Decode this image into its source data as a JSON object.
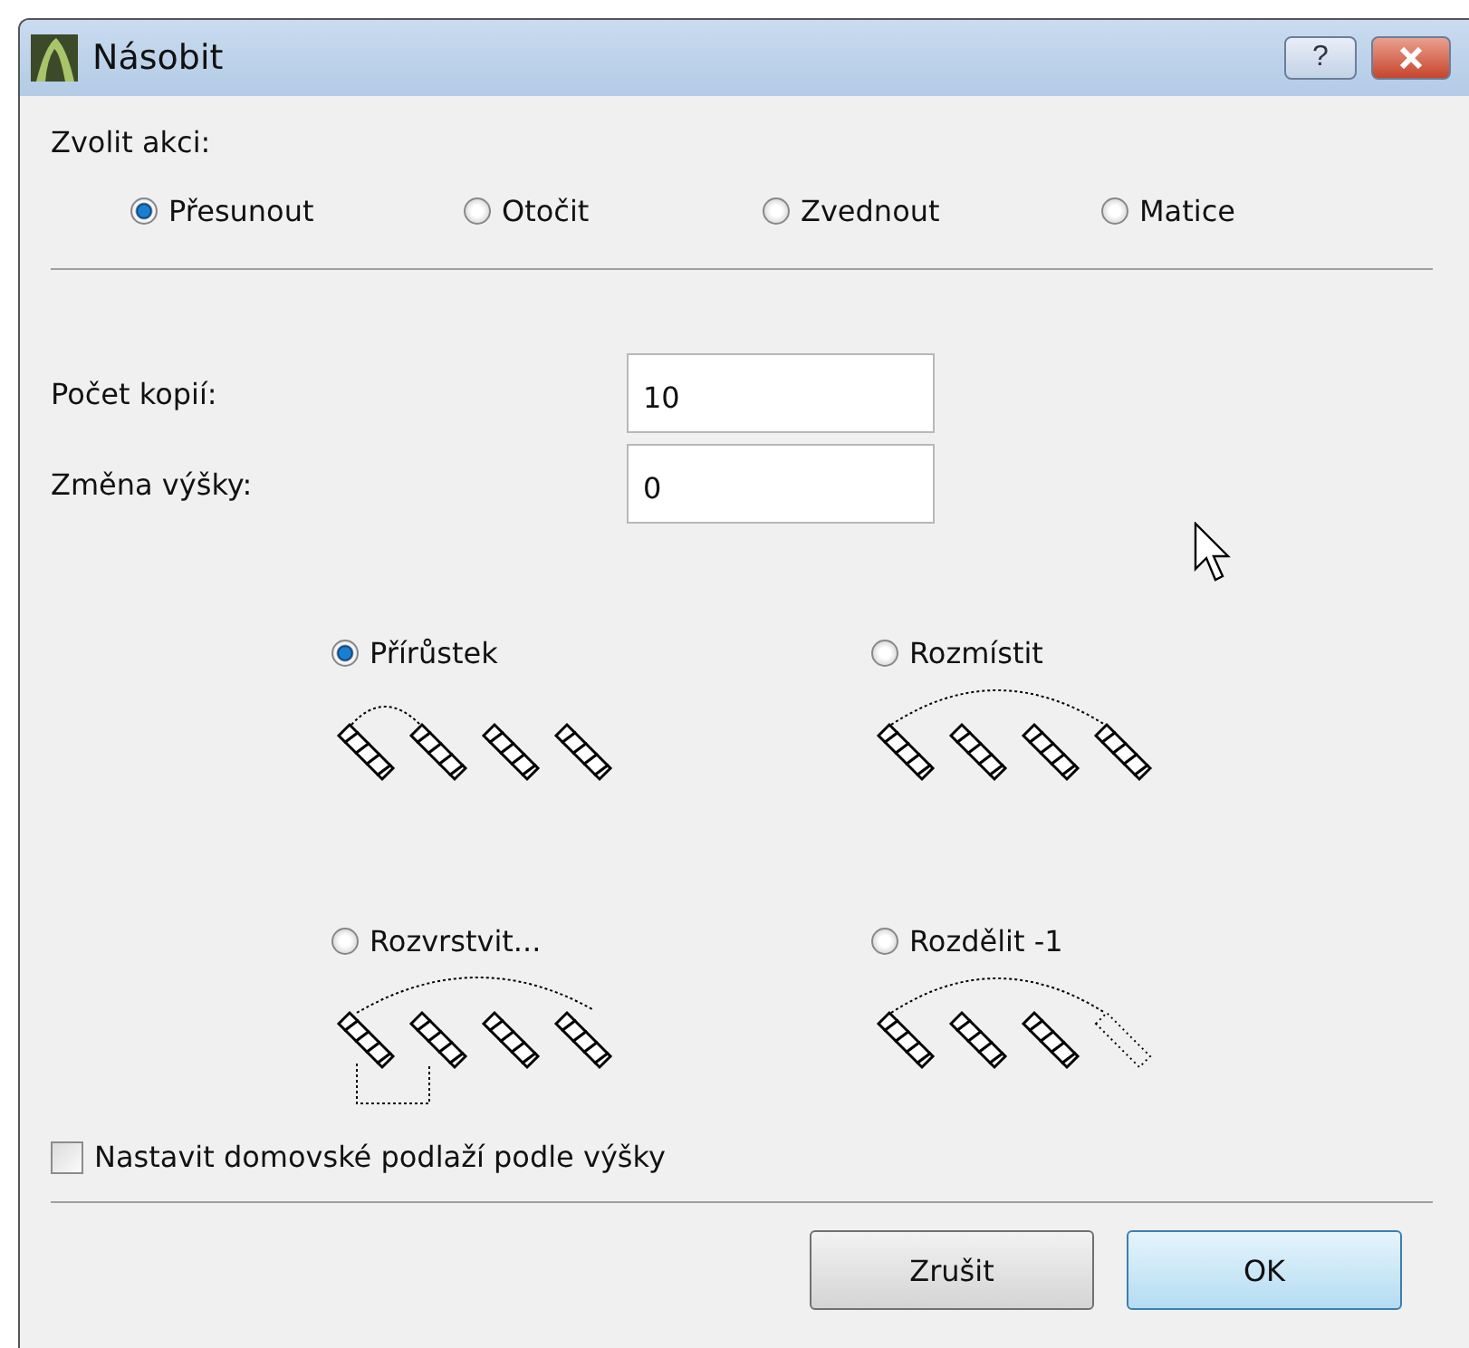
{
  "window": {
    "title": "Násobit",
    "help_button": "?"
  },
  "action": {
    "label": "Zvolit akci:",
    "options": [
      {
        "label": "Přesunout",
        "selected": true
      },
      {
        "label": "Otočit",
        "selected": false
      },
      {
        "label": "Zvednout",
        "selected": false
      },
      {
        "label": "Matice",
        "selected": false
      }
    ]
  },
  "fields": [
    {
      "label": "Počet kopií:",
      "value": "10"
    },
    {
      "label": "Změna výšky:",
      "value": "0"
    }
  ],
  "methods": [
    {
      "label": "Přírůstek",
      "kind": "increment",
      "selected": true
    },
    {
      "label": "Rozmístit",
      "kind": "distribute",
      "selected": false
    },
    {
      "label": "Rozvrstvit...",
      "kind": "spread",
      "selected": false
    },
    {
      "label": "Rozdělit -1",
      "kind": "divide",
      "selected": false
    }
  ],
  "home_story": {
    "label": "Nastavit domovské podlaží podle výšky",
    "checked": false
  },
  "buttons": [
    {
      "label": "Zrušit",
      "default": false
    },
    {
      "label": "OK",
      "default": true
    }
  ]
}
